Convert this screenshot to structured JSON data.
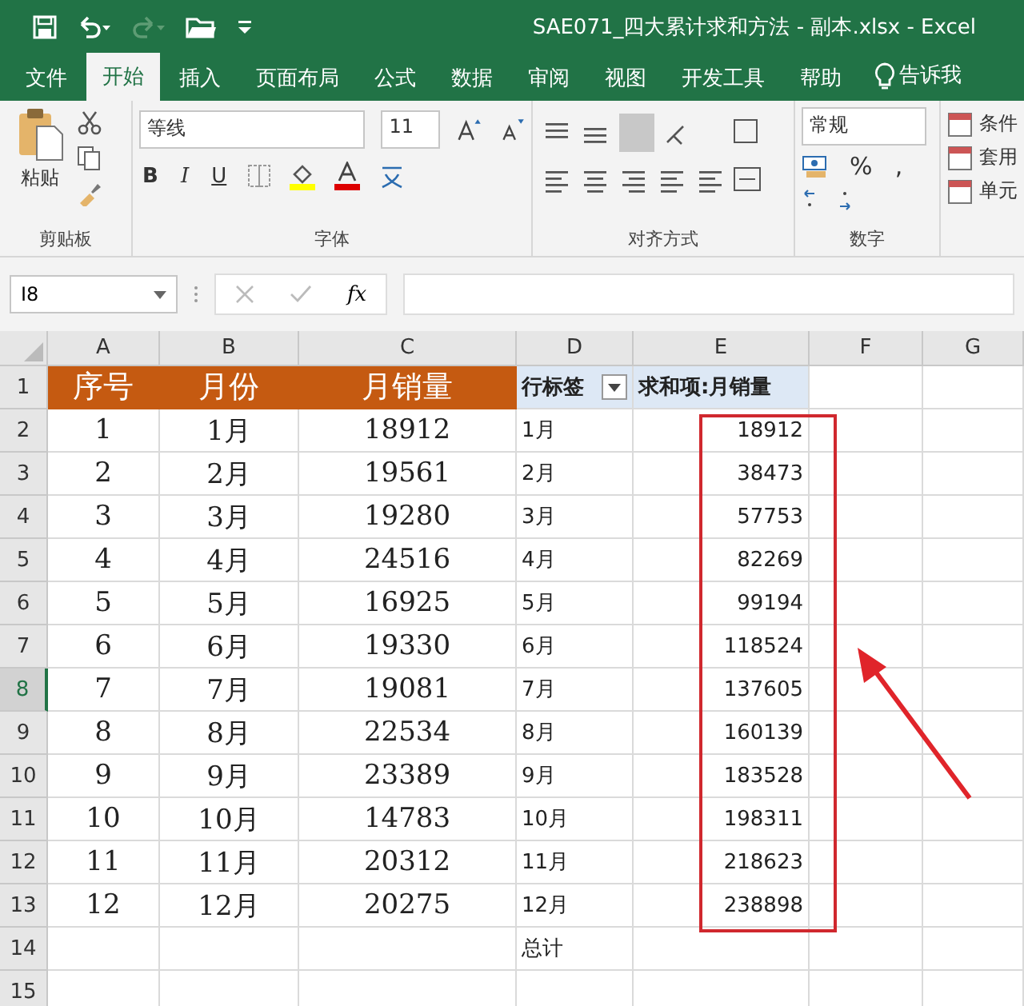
{
  "window": {
    "title": "SAE071_四大累计求和方法 - 副本.xlsx  -  Excel"
  },
  "tabs": [
    {
      "label": "文件",
      "selected": false
    },
    {
      "label": "开始",
      "selected": true
    },
    {
      "label": "插入",
      "selected": false
    },
    {
      "label": "页面布局",
      "selected": false
    },
    {
      "label": "公式",
      "selected": false
    },
    {
      "label": "数据",
      "selected": false
    },
    {
      "label": "审阅",
      "selected": false
    },
    {
      "label": "视图",
      "selected": false
    },
    {
      "label": "开发工具",
      "selected": false
    },
    {
      "label": "帮助",
      "selected": false
    }
  ],
  "tell_me": "告诉我",
  "ribbon": {
    "clipboard": {
      "paste": "粘贴",
      "group": "剪贴板"
    },
    "font": {
      "name": "等线",
      "size": "11",
      "bold": "B",
      "italic": "I",
      "underline": "U",
      "group": "字体"
    },
    "alignment": {
      "group": "对齐方式"
    },
    "number": {
      "format": "常规",
      "percent": "%",
      "comma": ",",
      "group": "数字"
    },
    "styles": [
      "条件",
      "套用",
      "单元"
    ]
  },
  "name_box": "I8",
  "fx": "fx",
  "columns": [
    "A",
    "B",
    "C",
    "D",
    "E",
    "F",
    "G"
  ],
  "rows": [
    {
      "number": "1",
      "selected": false,
      "kind": "header",
      "a": "序号",
      "b": "月份",
      "c": "月销量",
      "d": "行标签",
      "e": "求和项:月销量"
    },
    {
      "number": "2",
      "selected": false,
      "kind": "data",
      "a": "1",
      "b": "1月",
      "c": "18912",
      "d": "1月",
      "e": "18912"
    },
    {
      "number": "3",
      "selected": false,
      "kind": "data",
      "a": "2",
      "b": "2月",
      "c": "19561",
      "d": "2月",
      "e": "38473"
    },
    {
      "number": "4",
      "selected": false,
      "kind": "data",
      "a": "3",
      "b": "3月",
      "c": "19280",
      "d": "3月",
      "e": "57753"
    },
    {
      "number": "5",
      "selected": false,
      "kind": "data",
      "a": "4",
      "b": "4月",
      "c": "24516",
      "d": "4月",
      "e": "82269"
    },
    {
      "number": "6",
      "selected": false,
      "kind": "data",
      "a": "5",
      "b": "5月",
      "c": "16925",
      "d": "5月",
      "e": "99194"
    },
    {
      "number": "7",
      "selected": false,
      "kind": "data",
      "a": "6",
      "b": "6月",
      "c": "19330",
      "d": "6月",
      "e": "118524"
    },
    {
      "number": "8",
      "selected": true,
      "kind": "data",
      "a": "7",
      "b": "7月",
      "c": "19081",
      "d": "7月",
      "e": "137605"
    },
    {
      "number": "9",
      "selected": false,
      "kind": "data",
      "a": "8",
      "b": "8月",
      "c": "22534",
      "d": "8月",
      "e": "160139"
    },
    {
      "number": "10",
      "selected": false,
      "kind": "data",
      "a": "9",
      "b": "9月",
      "c": "23389",
      "d": "9月",
      "e": "183528"
    },
    {
      "number": "11",
      "selected": false,
      "kind": "data",
      "a": "10",
      "b": "10月",
      "c": "14783",
      "d": "10月",
      "e": "198311"
    },
    {
      "number": "12",
      "selected": false,
      "kind": "data",
      "a": "11",
      "b": "11月",
      "c": "20312",
      "d": "11月",
      "e": "218623"
    },
    {
      "number": "13",
      "selected": false,
      "kind": "data",
      "a": "12",
      "b": "12月",
      "c": "20275",
      "d": "12月",
      "e": "238898"
    },
    {
      "number": "14",
      "selected": false,
      "kind": "data",
      "d": "总计"
    },
    {
      "number": "15",
      "selected": false,
      "kind": "data"
    }
  ]
}
